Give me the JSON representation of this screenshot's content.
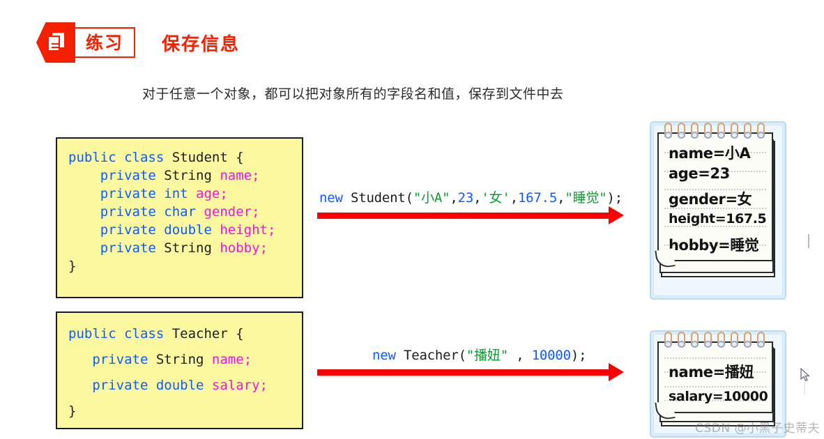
{
  "header": {
    "icon_name": "document-hexagon-icon",
    "badge_label": "练习",
    "title": "保存信息",
    "accent_color": "#f42000"
  },
  "subtitle": "对于任意一个对象，都可以把对象所有的字段名和值，保存到文件中去",
  "code_blocks": [
    {
      "id": "student",
      "background": "#fbf8a0",
      "lines": [
        {
          "segments": [
            {
              "text": "public class ",
              "style": "kw"
            },
            {
              "text": "Student {",
              "style": "type"
            }
          ]
        },
        {
          "segments": [
            {
              "text": "    private ",
              "style": "kw"
            },
            {
              "text": "String ",
              "style": "type"
            },
            {
              "text": "name",
              "style": "fld"
            },
            {
              "text": ";",
              "style": "fld"
            }
          ]
        },
        {
          "segments": [
            {
              "text": "    private int ",
              "style": "kw"
            },
            {
              "text": "age",
              "style": "fld"
            },
            {
              "text": ";",
              "style": "fld"
            }
          ]
        },
        {
          "segments": [
            {
              "text": "    private char ",
              "style": "kw"
            },
            {
              "text": "gender",
              "style": "fld"
            },
            {
              "text": ";",
              "style": "fld"
            }
          ]
        },
        {
          "segments": [
            {
              "text": "    private double ",
              "style": "kw"
            },
            {
              "text": "height",
              "style": "fld"
            },
            {
              "text": ";",
              "style": "fld"
            }
          ]
        },
        {
          "segments": [
            {
              "text": "    private ",
              "style": "kw"
            },
            {
              "text": "String ",
              "style": "type"
            },
            {
              "text": "hobby",
              "style": "fld"
            },
            {
              "text": ";",
              "style": "fld"
            }
          ]
        },
        {
          "segments": [
            {
              "text": "}",
              "style": "pl"
            }
          ]
        }
      ]
    },
    {
      "id": "teacher",
      "background": "#fbf8a0",
      "lines": [
        {
          "segments": [
            {
              "text": "public class ",
              "style": "kw"
            },
            {
              "text": "Teacher {",
              "style": "type"
            }
          ]
        },
        {
          "segments": [
            {
              "text": "   private ",
              "style": "kw"
            },
            {
              "text": "String ",
              "style": "type"
            },
            {
              "text": "name",
              "style": "fld"
            },
            {
              "text": ";",
              "style": "fld"
            }
          ]
        },
        {
          "segments": [
            {
              "text": "   private double ",
              "style": "kw"
            },
            {
              "text": "salary",
              "style": "fld"
            },
            {
              "text": ";",
              "style": "fld"
            }
          ]
        },
        {
          "segments": [
            {
              "text": "}",
              "style": "pl"
            }
          ]
        }
      ]
    }
  ],
  "expressions": [
    {
      "id": "student",
      "segments": [
        {
          "text": "new ",
          "style": "kw"
        },
        {
          "text": "Student(",
          "style": "pl"
        },
        {
          "text": "\"小A\"",
          "style": "str"
        },
        {
          "text": ",",
          "style": "pl"
        },
        {
          "text": "23",
          "style": "num"
        },
        {
          "text": ",",
          "style": "pl"
        },
        {
          "text": "'女'",
          "style": "str"
        },
        {
          "text": ",",
          "style": "pl"
        },
        {
          "text": "167.5",
          "style": "num"
        },
        {
          "text": ",",
          "style": "pl"
        },
        {
          "text": "\"睡觉\"",
          "style": "str"
        },
        {
          "text": ");",
          "style": "pl"
        }
      ]
    },
    {
      "id": "teacher",
      "segments": [
        {
          "text": "new ",
          "style": "kw"
        },
        {
          "text": "Teacher(",
          "style": "pl"
        },
        {
          "text": "\"播妞\"",
          "style": "str"
        },
        {
          "text": " , ",
          "style": "pl"
        },
        {
          "text": "10000",
          "style": "num"
        },
        {
          "text": ");",
          "style": "pl"
        }
      ]
    }
  ],
  "arrows": [
    {
      "id": "student",
      "color": "#fa0000",
      "direction": "right"
    },
    {
      "id": "teacher",
      "color": "#fa0000",
      "direction": "right"
    }
  ],
  "notepads": [
    {
      "id": "student",
      "rings": 8,
      "lines": [
        "name=小A",
        "age=23",
        "gender=女",
        "height=167.5",
        "hobby=睡觉"
      ]
    },
    {
      "id": "teacher",
      "rings": 8,
      "lines": [
        "name=播妞",
        "salary=10000"
      ]
    }
  ],
  "watermark": "CSDN @小黑子史蒂夫",
  "cursor": {
    "name": "mouse-pointer"
  }
}
